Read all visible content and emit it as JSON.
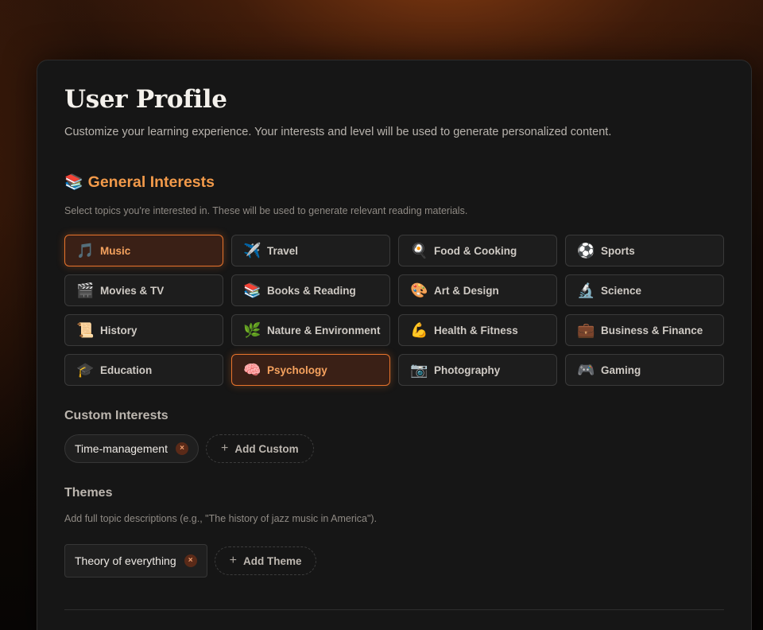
{
  "header": {
    "title": "User Profile",
    "subtitle": "Customize your learning experience. Your interests and level will be used to generate personalized content."
  },
  "general_interests": {
    "emoji": "📚",
    "title": "General Interests",
    "description": "Select topics you're interested in. These will be used to generate relevant reading materials.",
    "items": [
      {
        "icon": "🎵",
        "label": "Music",
        "selected": true
      },
      {
        "icon": "✈️",
        "label": "Travel",
        "selected": false
      },
      {
        "icon": "🍳",
        "label": "Food & Cooking",
        "selected": false
      },
      {
        "icon": "⚽",
        "label": "Sports",
        "selected": false
      },
      {
        "icon": "🎬",
        "label": "Movies & TV",
        "selected": false
      },
      {
        "icon": "📚",
        "label": "Books & Reading",
        "selected": false
      },
      {
        "icon": "🎨",
        "label": "Art & Design",
        "selected": false
      },
      {
        "icon": "🔬",
        "label": "Science",
        "selected": false
      },
      {
        "icon": "📜",
        "label": "History",
        "selected": false
      },
      {
        "icon": "🌿",
        "label": "Nature & Environment",
        "selected": false
      },
      {
        "icon": "💪",
        "label": "Health & Fitness",
        "selected": false
      },
      {
        "icon": "💼",
        "label": "Business & Finance",
        "selected": false
      },
      {
        "icon": "🎓",
        "label": "Education",
        "selected": false
      },
      {
        "icon": "🧠",
        "label": "Psychology",
        "selected": true
      },
      {
        "icon": "📷",
        "label": "Photography",
        "selected": false
      },
      {
        "icon": "🎮",
        "label": "Gaming",
        "selected": false
      }
    ]
  },
  "custom_interests": {
    "title": "Custom Interests",
    "tags": [
      "Time-management"
    ],
    "remove_glyph": "×",
    "add_plus": "+",
    "add_label": "Add Custom"
  },
  "themes": {
    "title": "Themes",
    "description": "Add full topic descriptions (e.g., \"The history of jazz music in America\").",
    "tags": [
      "Theory of everything"
    ],
    "remove_glyph": "×",
    "add_plus": "+",
    "add_label": "Add Theme"
  },
  "colors": {
    "accent": "#f29a4a",
    "selected_border": "#e8742c",
    "card_bg": "#161616"
  }
}
